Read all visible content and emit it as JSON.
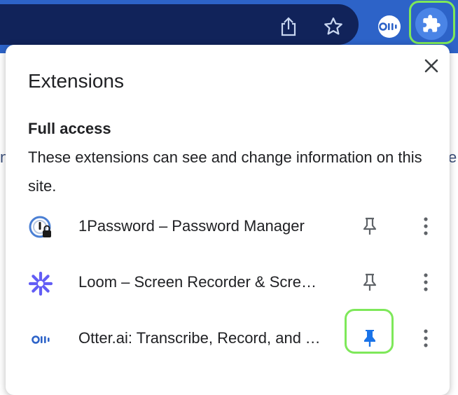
{
  "toolbar": {
    "icons": [
      "share-icon",
      "star-icon",
      "otter-icon",
      "puzzle-icon"
    ],
    "otter_logo_text": "Oll·",
    "highlight_color": "#7ee85a",
    "toolbar_color": "#2d63c8",
    "omnibox_color": "#11235a"
  },
  "popup": {
    "title": "Extensions",
    "section_title": "Full access",
    "section_desc": "These extensions can see and change information on this site.",
    "extensions": [
      {
        "name": "1Password – Password Manager",
        "icon": "onepassword-icon",
        "pinned": false
      },
      {
        "name": "Loom – Screen Recorder & Screen Capture",
        "icon": "loom-icon",
        "pinned": false
      },
      {
        "name": "Otter.ai: Transcribe, Record, and Take Notes",
        "icon": "otter-icon",
        "pinned": true,
        "logo_text": "Oll·"
      }
    ],
    "pin_active_color": "#1a73e8"
  },
  "background": {
    "fragment_left": "n",
    "fragment_right": "e"
  }
}
